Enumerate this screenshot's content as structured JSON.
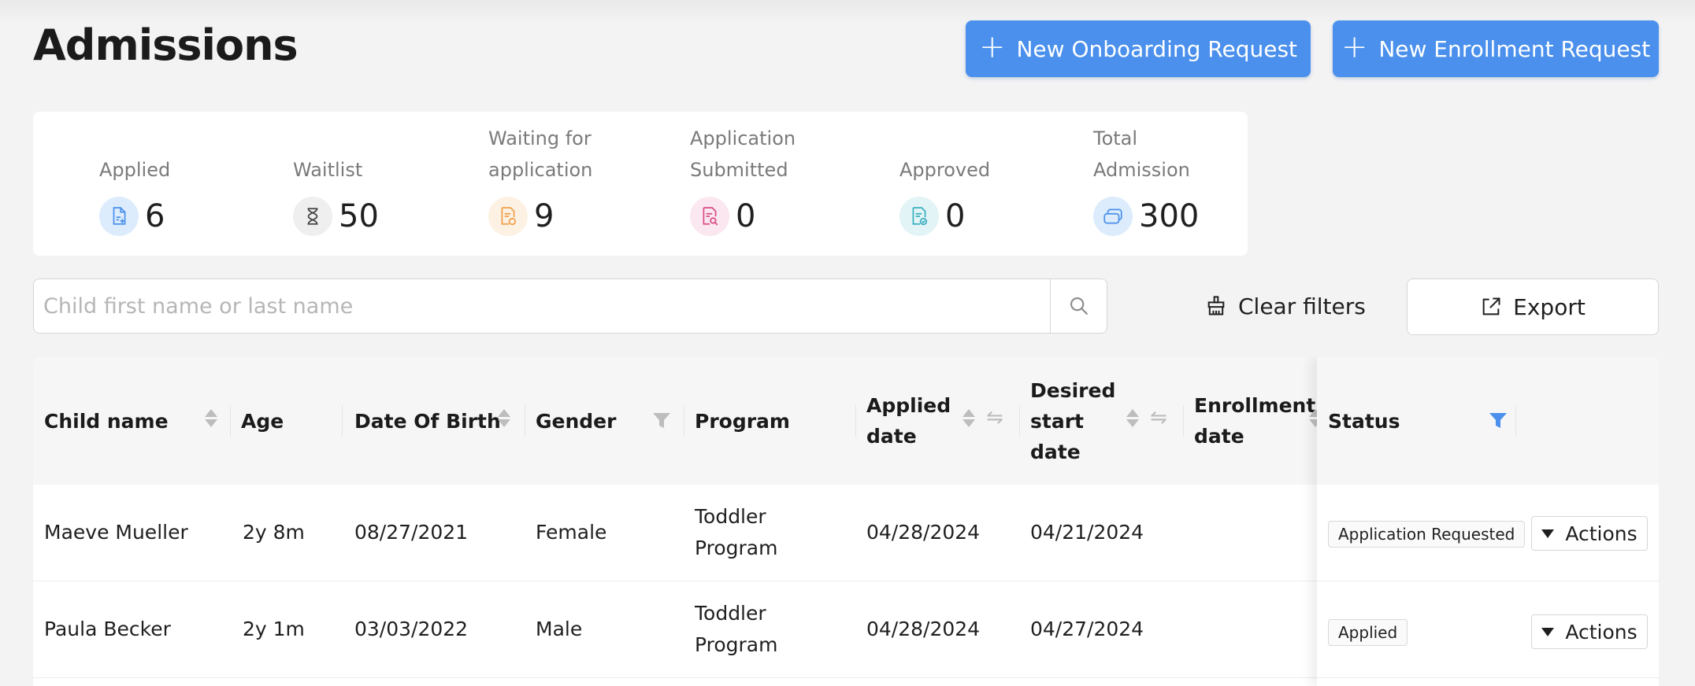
{
  "header": {
    "title": "Admissions",
    "new_onboarding_label": "New Onboarding Request",
    "new_enrollment_label": "New Enrollment Request"
  },
  "stats": [
    {
      "label_line1": "",
      "label_line2": "Applied",
      "value": "6",
      "icon": "document-plus-icon",
      "icon_bg": "#dcecfc",
      "icon_color": "#4a90ec"
    },
    {
      "label_line1": "",
      "label_line2": "Waitlist",
      "value": "50",
      "icon": "hourglass-icon",
      "icon_bg": "#efefef",
      "icon_color": "#444444"
    },
    {
      "label_line1": "Waiting for",
      "label_line2": "application",
      "value": "9",
      "icon": "document-refresh-icon",
      "icon_bg": "#fdf1e3",
      "icon_color": "#f0a04b"
    },
    {
      "label_line1": "Application",
      "label_line2": "Submitted",
      "value": "0",
      "icon": "document-search-icon",
      "icon_bg": "#fbe7ef",
      "icon_color": "#d94b86"
    },
    {
      "label_line1": "",
      "label_line2": "Approved",
      "value": "0",
      "icon": "document-check-icon",
      "icon_bg": "#e2f4f6",
      "icon_color": "#3aaec0"
    },
    {
      "label_line1": "Total",
      "label_line2": "Admission",
      "value": "300",
      "icon": "stack-icon",
      "icon_bg": "#dcecfc",
      "icon_color": "#4a90ec"
    }
  ],
  "search": {
    "placeholder": "Child first name or last name",
    "value": ""
  },
  "toolbar": {
    "clear_filters_label": "Clear filters",
    "export_label": "Export"
  },
  "table": {
    "columns": {
      "child_name": "Child name",
      "age": "Age",
      "dob": "Date Of Birth",
      "gender": "Gender",
      "program": "Program",
      "applied_date": "Applied date",
      "desired_start": "Desired start date",
      "enrollment_date": "Enrollment date",
      "status": "Status"
    },
    "rows": [
      {
        "child_name": "Maeve Mueller",
        "age": "2y 8m",
        "dob": "08/27/2021",
        "gender": "Female",
        "program": "Toddler Program",
        "applied_date": "04/28/2024",
        "desired_start": "04/21/2024",
        "enrollment_date": "",
        "status": "Application Requested",
        "actions_label": "Actions"
      },
      {
        "child_name": "Paula Becker",
        "age": "2y 1m",
        "dob": "03/03/2022",
        "gender": "Male",
        "program": "Toddler Program",
        "applied_date": "04/28/2024",
        "desired_start": "04/27/2024",
        "enrollment_date": "",
        "status": "Applied",
        "actions_label": "Actions"
      }
    ]
  },
  "colors": {
    "primary": "#4a90ec",
    "status_filter_active": "#4a90ec",
    "filter_inactive": "#bdbdbd"
  }
}
